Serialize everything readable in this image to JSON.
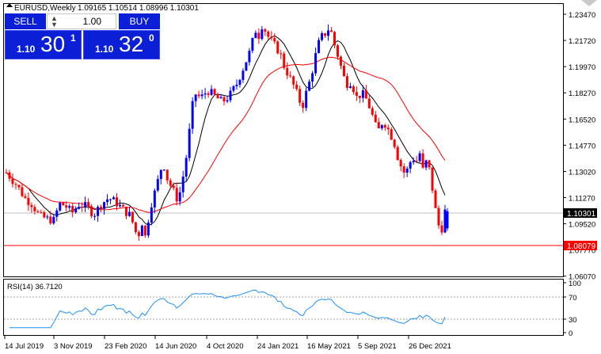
{
  "chart_header": {
    "symbol_timeframe": "EURUSD,Weekly",
    "ohlc": "1.09165 1.10514 1.08996 1.10301"
  },
  "trade_panel": {
    "sell_label": "SELL",
    "buy_label": "BUY",
    "lot_value": "1.00",
    "sell_small": "1.10",
    "sell_big": "30",
    "sell_sup": "1",
    "buy_small": "1.10",
    "buy_big": "32",
    "buy_sup": "0"
  },
  "price_axis": {
    "ticks": [
      "1.23470",
      "1.21720",
      "1.19970",
      "1.18270",
      "1.16520",
      "1.14770",
      "1.13020",
      "1.11270",
      "1.09520",
      "1.07770",
      "1.06070"
    ],
    "current_price_label": "1.10301",
    "level_line_label": "1.08079"
  },
  "rsi_panel": {
    "label": "RSI(14) 36.7120",
    "ticks": [
      "100",
      "70",
      "30",
      "0"
    ]
  },
  "time_axis": {
    "labels": [
      "14 Jul 2019",
      "3 Nov 2019",
      "23 Feb 2020",
      "14 Jun 2020",
      "4 Oct 2020",
      "24 Jan 2021",
      "16 May 2021",
      "5 Sep 2021",
      "26 Dec 2021"
    ]
  },
  "colors": {
    "bull_candle": "#0000ff",
    "bear_candle": "#ff0000",
    "ma_fast": "#000000",
    "ma_slow": "#ff0000",
    "rsi_line": "#1e90ff",
    "level_line": "#ff0000",
    "price_marker_bg": "#000000"
  },
  "chart_data": {
    "type": "candlestick",
    "symbol": "EURUSD",
    "timeframe": "Weekly",
    "last_ohlc": {
      "open": 1.09165,
      "high": 1.10514,
      "low": 1.08996,
      "close": 1.10301
    },
    "ylim": [
      1.0607,
      1.2347
    ],
    "horizontal_level": 1.08079,
    "current_price": 1.10301,
    "rsi": {
      "period": 14,
      "last": 36.712,
      "levels": [
        70,
        30
      ],
      "ylim": [
        0,
        100
      ]
    }
  }
}
